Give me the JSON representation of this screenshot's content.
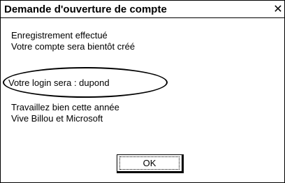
{
  "window": {
    "title": "Demande d'ouverture de compte",
    "close_glyph": "✕"
  },
  "message": {
    "line1": "Enregistrement effectué",
    "line2": "Votre compte sera bientôt créé",
    "login_line": "Votre login sera : dupond",
    "line4": "Travaillez bien cette année",
    "line5": "Vive Billou et Microsoft"
  },
  "buttons": {
    "ok_label": "OK"
  }
}
